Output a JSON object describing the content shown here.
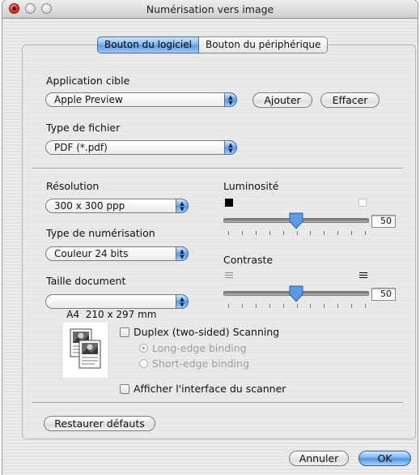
{
  "window": {
    "title": "Numérisation vers image"
  },
  "tabs": [
    {
      "label": "Bouton du logiciel",
      "active": true
    },
    {
      "label": "Bouton du périphérique",
      "active": false
    }
  ],
  "target_app": {
    "label": "Application cible",
    "value": "Apple Preview",
    "add_label": "Ajouter",
    "delete_label": "Effacer"
  },
  "file_type": {
    "label": "Type de fichier",
    "value": "PDF (*.pdf)"
  },
  "resolution": {
    "label": "Résolution",
    "value": "300 x 300 ppp"
  },
  "scan_type": {
    "label": "Type de numérisation",
    "value": "Couleur 24 bits"
  },
  "doc_size": {
    "label": "Taille document",
    "value": "A4  210 x 297 mm"
  },
  "brightness": {
    "label": "Luminosité",
    "value": "50",
    "level": 50
  },
  "contrast": {
    "label": "Contraste",
    "value": "50",
    "level": 50
  },
  "duplex": {
    "label": "Duplex (two-sided) Scanning",
    "checked": false,
    "long_edge": "Long-edge binding",
    "short_edge": "Short-edge binding"
  },
  "show_scanner_ui": {
    "label": "Afficher l'interface du scanner",
    "checked": false
  },
  "restore_label": "Restaurer défauts",
  "cancel_label": "Annuler",
  "ok_label": "OK"
}
